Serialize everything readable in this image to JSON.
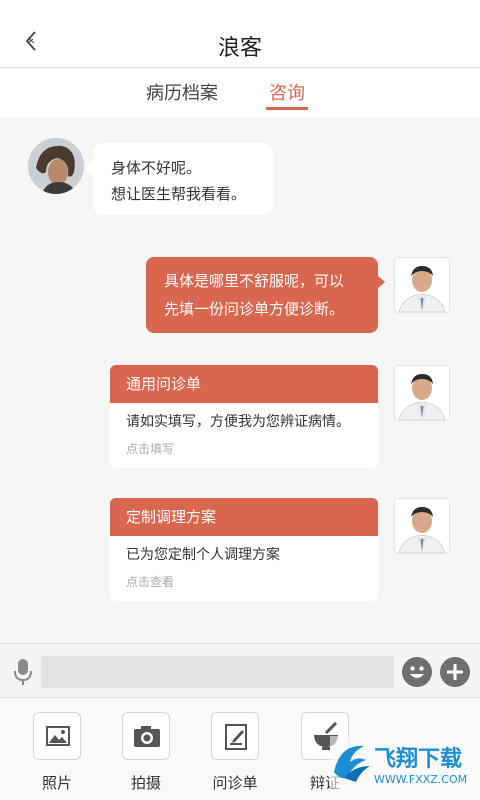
{
  "header": {
    "title": "浪客"
  },
  "tabs": [
    {
      "label": "病历档案",
      "active": false
    },
    {
      "label": "咨询",
      "active": true
    }
  ],
  "messages": {
    "patient": {
      "line1": "身体不好呢。",
      "line2": "想让医生帮我看看。"
    },
    "doctor": {
      "line1": "具体是哪里不舒服呢，可以",
      "line2": "先填一份问诊单方便诊断。"
    }
  },
  "cards": [
    {
      "title": "通用问诊单",
      "text": "请如实填写，方便我为您辨证病情。",
      "action": "点击填写"
    },
    {
      "title": "定制调理方案",
      "text": "已为您定制个人调理方案",
      "action": "点击查看"
    }
  ],
  "input": {
    "placeholder": ""
  },
  "tools": [
    {
      "label": "照片",
      "icon": "photo-icon"
    },
    {
      "label": "拍摄",
      "icon": "camera-icon"
    },
    {
      "label": "问诊单",
      "icon": "form-icon"
    },
    {
      "label": "辩证",
      "icon": "mortar-icon"
    }
  ],
  "watermark": {
    "brand": "飞翔下载",
    "url": "WWW.FXXZ.COM"
  },
  "colors": {
    "accent": "#d9674f",
    "background": "#f6f6f4"
  }
}
